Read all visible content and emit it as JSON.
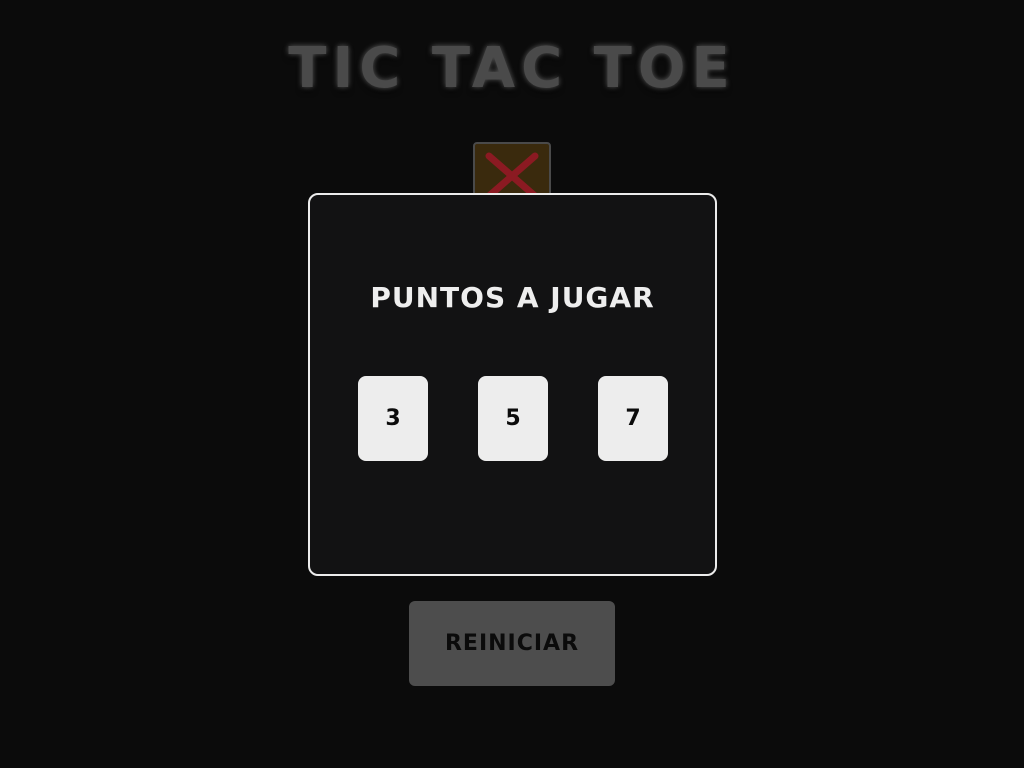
{
  "game": {
    "title": "TIC TAC TOE",
    "turn_symbol": "x-mark-icon",
    "reset_label": "REINICIAR"
  },
  "modal": {
    "title": "PUNTOS A JUGAR",
    "options": [
      "3",
      "5",
      "7"
    ]
  },
  "colors": {
    "background": "#0b0b0b",
    "modal_background": "#121213",
    "modal_border": "#ececec",
    "option_background": "#ededed",
    "x_mark": "#8b1a22",
    "turn_tile": "#3a2a0d",
    "reset_button": "#4d4d4d"
  }
}
